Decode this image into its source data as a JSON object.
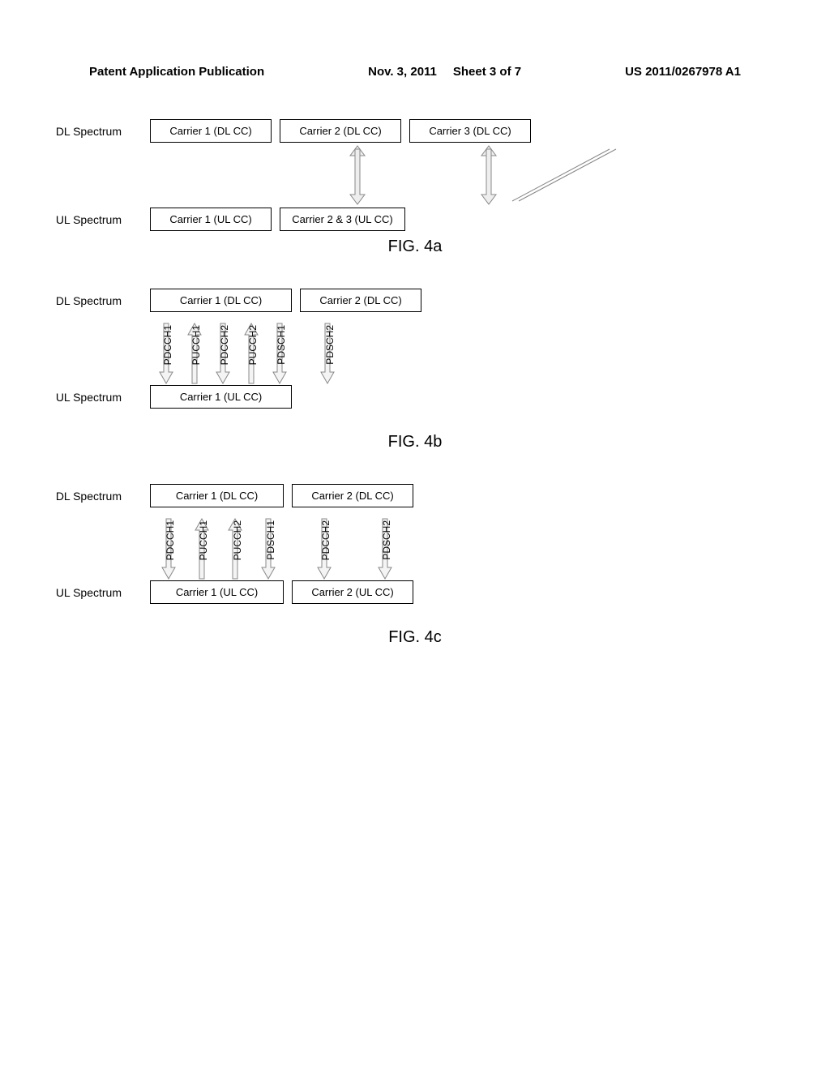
{
  "header": {
    "left": "Patent Application Publication",
    "date": "Nov. 3, 2011",
    "sheet": "Sheet 3 of 7",
    "pubno": "US 2011/0267978 A1"
  },
  "fig4a": {
    "label": "FIG. 4a",
    "dl_label": "DL Spectrum",
    "ul_label": "UL Spectrum",
    "dl": [
      "Carrier 1 (DL CC)",
      "Carrier 2 (DL CC)",
      "Carrier 3 (DL CC)"
    ],
    "ul": [
      "Carrier 1 (UL CC)",
      "Carrier 2 & 3 (UL CC)"
    ]
  },
  "fig4b": {
    "label": "FIG. 4b",
    "dl_label": "DL Spectrum",
    "ul_label": "UL Spectrum",
    "dl": [
      "Carrier 1 (DL CC)",
      "Carrier 2 (DL CC)"
    ],
    "ul": [
      "Carrier 1 (UL CC)"
    ],
    "channels_dl1": [
      "PDCCH1",
      "PUCCH1",
      "PDCCH2",
      "PUCCH2",
      "PDSCH1"
    ],
    "channels_dl2": [
      "PDSCH2"
    ],
    "channel_dirs_dl1": [
      "down",
      "up",
      "down",
      "up",
      "down"
    ],
    "channel_dirs_dl2": [
      "down"
    ]
  },
  "fig4c": {
    "label": "FIG. 4c",
    "dl_label": "DL Spectrum",
    "ul_label": "UL Spectrum",
    "dl": [
      "Carrier 1 (DL CC)",
      "Carrier 2 (DL CC)"
    ],
    "ul": [
      "Carrier 1 (UL CC)",
      "Carrier 2 (UL CC)"
    ],
    "channels_dl1": [
      "PDCCH1",
      "PUCCH1",
      "PUCCH2",
      "PDSCH1"
    ],
    "channels_dl2": [
      "PDCCH2",
      "PDSCH2"
    ],
    "channel_dirs_dl1": [
      "down",
      "up",
      "up",
      "down"
    ],
    "channel_dirs_dl2": [
      "down",
      "down"
    ]
  }
}
